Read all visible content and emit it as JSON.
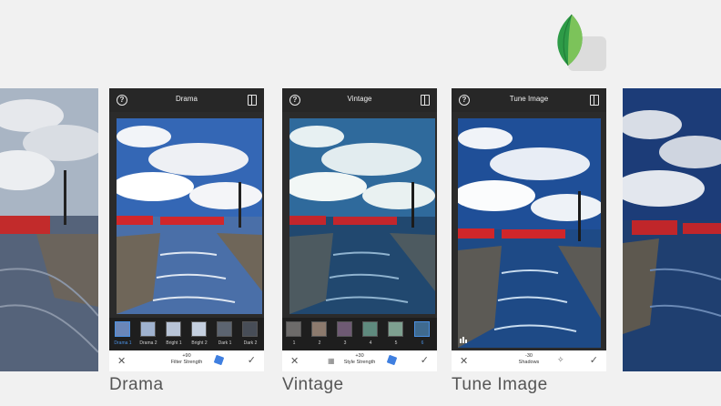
{
  "logo": {
    "name": "snapseed-logo"
  },
  "screens": [
    {
      "title": "Drama",
      "caption": "Drama",
      "thumbs": [
        "Drama 1",
        "Drama 2",
        "Bright 1",
        "Bright 2",
        "Dark 1",
        "Dark 2"
      ],
      "selected_thumb": 0,
      "value": "+90",
      "value_label": "Filter Strength"
    },
    {
      "title": "Vintage",
      "caption": "Vintage",
      "thumbs": [
        "1",
        "2",
        "3",
        "4",
        "5",
        "6"
      ],
      "selected_thumb": 5,
      "value": "+30",
      "value_label": "Style Strength"
    },
    {
      "title": "Tune Image",
      "caption": "Tune Image",
      "value": "-30",
      "value_label": "Shadows"
    }
  ],
  "colors": {
    "accent": "#4a90e2",
    "bar_dark": "#272727",
    "bg": "#f1f1f1"
  },
  "icons": [
    "help-icon",
    "compare-icon",
    "close-icon",
    "check-icon",
    "style-stack-icon",
    "wand-icon",
    "histogram-icon"
  ]
}
